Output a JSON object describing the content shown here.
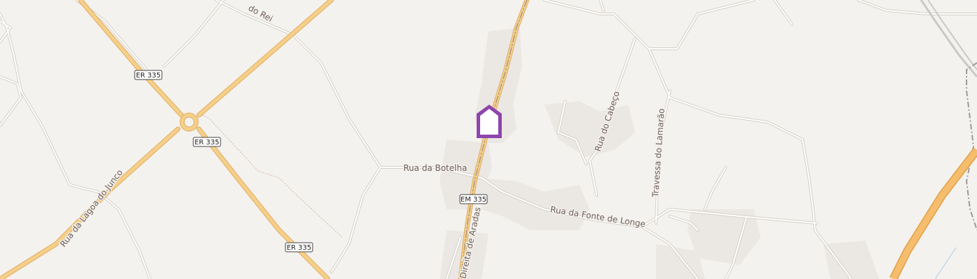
{
  "map": {
    "colors": {
      "background": "#f4f2ee",
      "minor_road": "#ffffff",
      "minor_road_casing": "#d4cfc8",
      "main_road": "#f5cf8a",
      "main_road_casing": "#e0ae63",
      "motorway": "#f2b35e",
      "rail": "#9b9b9b",
      "building": "#ebe7e2",
      "marker": "#8e44ad"
    },
    "marker": {
      "icon": "home-marker-icon"
    },
    "road_labels": {
      "rei": "do Rei",
      "botelha": "Rua da Botelha",
      "fonte_longe": "Rua da Fonte de Longe",
      "cabeco": "Rua do Cabeço",
      "lamarao": "Travessa do Lamarão",
      "lagoa_junco": "Rua da Lagoa do Junco",
      "aradas": "Direita de Aradas"
    },
    "shields": {
      "er335_a": "ER 335",
      "er335_b": "ER 335",
      "er335_c": "ER 335",
      "em335": "EM 335"
    }
  }
}
